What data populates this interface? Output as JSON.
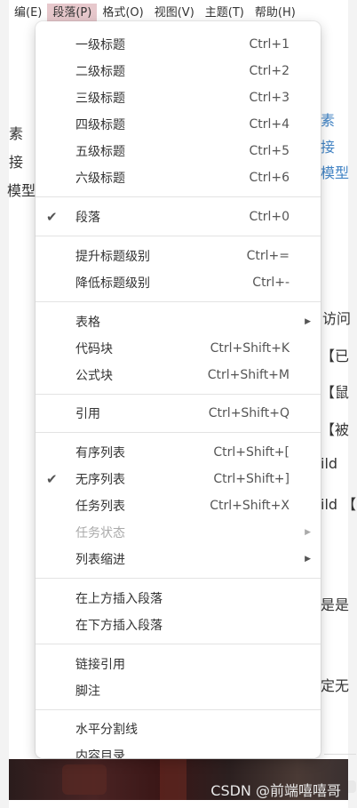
{
  "menubar": {
    "items": [
      "编(E)",
      "段落(P)",
      "格式(O)",
      "视图(V)",
      "主题(T)",
      "帮助(H)"
    ]
  },
  "background_text": {
    "left": [
      "素",
      "接",
      "模型"
    ],
    "right_links": [
      "素",
      "接",
      "模型"
    ],
    "right_fragments": [
      "访问",
      "【已",
      "【鼠",
      "【被",
      "ild",
      "ild 【",
      "是是",
      "定无"
    ]
  },
  "menu": {
    "group_headings": [
      {
        "label": "一级标题",
        "shortcut": "Ctrl+1"
      },
      {
        "label": "二级标题",
        "shortcut": "Ctrl+2"
      },
      {
        "label": "三级标题",
        "shortcut": "Ctrl+3"
      },
      {
        "label": "四级标题",
        "shortcut": "Ctrl+4"
      },
      {
        "label": "五级标题",
        "shortcut": "Ctrl+5"
      },
      {
        "label": "六级标题",
        "shortcut": "Ctrl+6"
      }
    ],
    "paragraph": {
      "label": "段落",
      "shortcut": "Ctrl+0",
      "checked": true
    },
    "level": [
      {
        "label": "提升标题级别",
        "shortcut": "Ctrl+="
      },
      {
        "label": "降低标题级别",
        "shortcut": "Ctrl+-"
      }
    ],
    "blocks": [
      {
        "label": "表格",
        "shortcut": ""
      },
      {
        "label": "代码块",
        "shortcut": "Ctrl+Shift+K"
      },
      {
        "label": "公式块",
        "shortcut": "Ctrl+Shift+M"
      }
    ],
    "quote": {
      "label": "引用",
      "shortcut": "Ctrl+Shift+Q"
    },
    "lists": [
      {
        "label": "有序列表",
        "shortcut": "Ctrl+Shift+["
      },
      {
        "label": "无序列表",
        "shortcut": "Ctrl+Shift+]",
        "checked": true
      },
      {
        "label": "任务列表",
        "shortcut": "Ctrl+Shift+X"
      },
      {
        "label": "任务状态",
        "shortcut": "",
        "disabled": true
      },
      {
        "label": "列表缩进",
        "shortcut": ""
      }
    ],
    "insert": [
      {
        "label": "在上方插入段落"
      },
      {
        "label": "在下方插入段落"
      }
    ],
    "refs": [
      {
        "label": "链接引用"
      },
      {
        "label": "脚注"
      }
    ],
    "misc": [
      {
        "label": "水平分割线"
      },
      {
        "label": "内容目录"
      }
    ]
  },
  "watermark": "CSDN @前端嘻嘻哥",
  "colors": {
    "menubar_active": "#e7c8cc",
    "link": "#4183c4"
  }
}
